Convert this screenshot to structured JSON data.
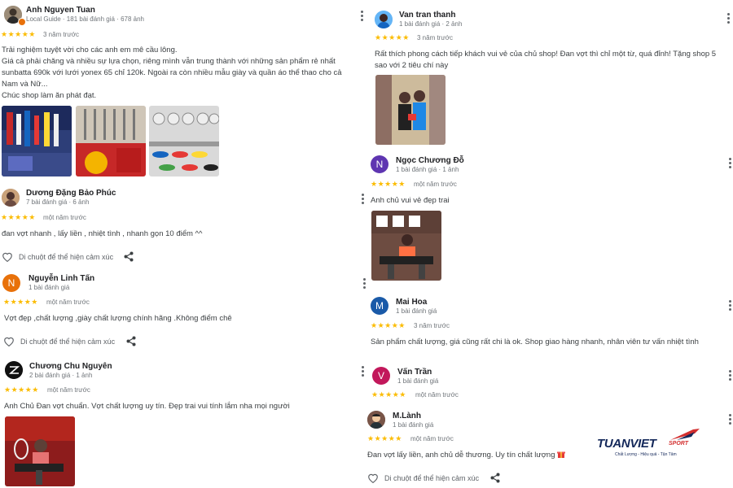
{
  "left": [
    {
      "name": "Anh Nguyen Tuan",
      "meta": "Local Guide · 181 bài đánh giá · 678 ảnh",
      "stars": "★★★★★",
      "date": "3 năm trước",
      "text_lines": [
        "Trải nghiệm tuyệt vời cho các anh em mê cầu lông.",
        "Giá cả phải chăng và nhiều sự lựa chọn, riêng mình vẫn trung thành với những sản phẩm rẻ nhất",
        "sunbatta 690k với lưới yonex 65 chỉ 120k. Ngoài ra còn nhiều mẫu giày và quần áo thể thao cho cả",
        "Nam và Nữ...",
        "Chúc shop làm ăn phát đạt."
      ]
    },
    {
      "name": "Dương Đặng Bảo Phúc",
      "meta": "7 bài đánh giá · 6 ảnh",
      "stars": "★★★★★",
      "date": "một năm trước",
      "text": "đan vợt nhanh , lấy liền , nhiệt tình , nhanh gọn 10 điểm ^^",
      "react": "Di chuột để thể hiện cảm xúc"
    },
    {
      "initial": "N",
      "name": "Nguyễn Linh Tấn",
      "meta": "1 bài đánh giá",
      "stars": "★★★★★",
      "date": "một năm trước",
      "text": "Vợt đẹp ,chất lượng ,giày chất lượng chính hãng .Không điểm chê",
      "react": "Di chuột để thể hiện cảm xúc"
    },
    {
      "name": "Chương Chu Nguyên",
      "meta": "2 bài đánh giá · 1 ảnh",
      "stars": "★★★★★",
      "date": "một năm trước",
      "text": "Anh Chủ Đan vợt chuẩn. Vợt chất lượng uy tín. Đẹp trai vui tính lắm nha mọi người"
    }
  ],
  "right": [
    {
      "name": "Van tran thanh",
      "meta": "1 bài đánh giá · 2 ảnh",
      "stars": "★★★★★",
      "date": "3 năm trước",
      "text_lines": [
        "Rất thích phong cách tiếp khách vui vẻ của chủ shop! Đan vợt thì chỉ một từ, quá đỉnh! Tặng shop 5",
        "sao với 2 tiêu chí này"
      ]
    },
    {
      "initial": "N",
      "name": "Ngọc Chương Đỗ",
      "meta": "1 bài đánh giá · 1 ảnh",
      "stars": "★★★★★",
      "date": "một năm trước",
      "text": "Anh chủ vui vẻ đẹp trai"
    },
    {
      "initial": "M",
      "name": "Mai Hoa",
      "meta": "1 bài đánh giá",
      "stars": "★★★★★",
      "date": "3 năm trước",
      "text": "Sản phẩm chất lượng, giá cũng rất chi là ok. Shop giao hàng nhanh, nhân viên tư vấn nhiệt tình"
    },
    {
      "initial": "V",
      "name": "Vấn Trần",
      "meta": "1 bài đánh giá",
      "stars": "★★★★★",
      "date": "một năm trước"
    },
    {
      "name": "M.Lành",
      "meta": "1 bài đánh giá",
      "stars": "★★★★★",
      "date": "một năm trước",
      "text": "Đan vợt lấy liền, anh chủ dễ thương. Uy tín chất lượng",
      "react": "Di chuột để thể hiện cảm xúc"
    }
  ],
  "logo": {
    "brand": "TUANVIET",
    "sub": "SPORT",
    "tagline": "Chất Lượng - Hiệu quả - Tận Tâm"
  },
  "colors": {
    "star": "#fbbc04",
    "avatar_orange": "#e8710a",
    "avatar_purple": "#5e35b1",
    "avatar_blue": "#1a5aa8",
    "avatar_magenta": "#c2185b",
    "logo_navy": "#14285a",
    "logo_red": "#d32f2f"
  }
}
